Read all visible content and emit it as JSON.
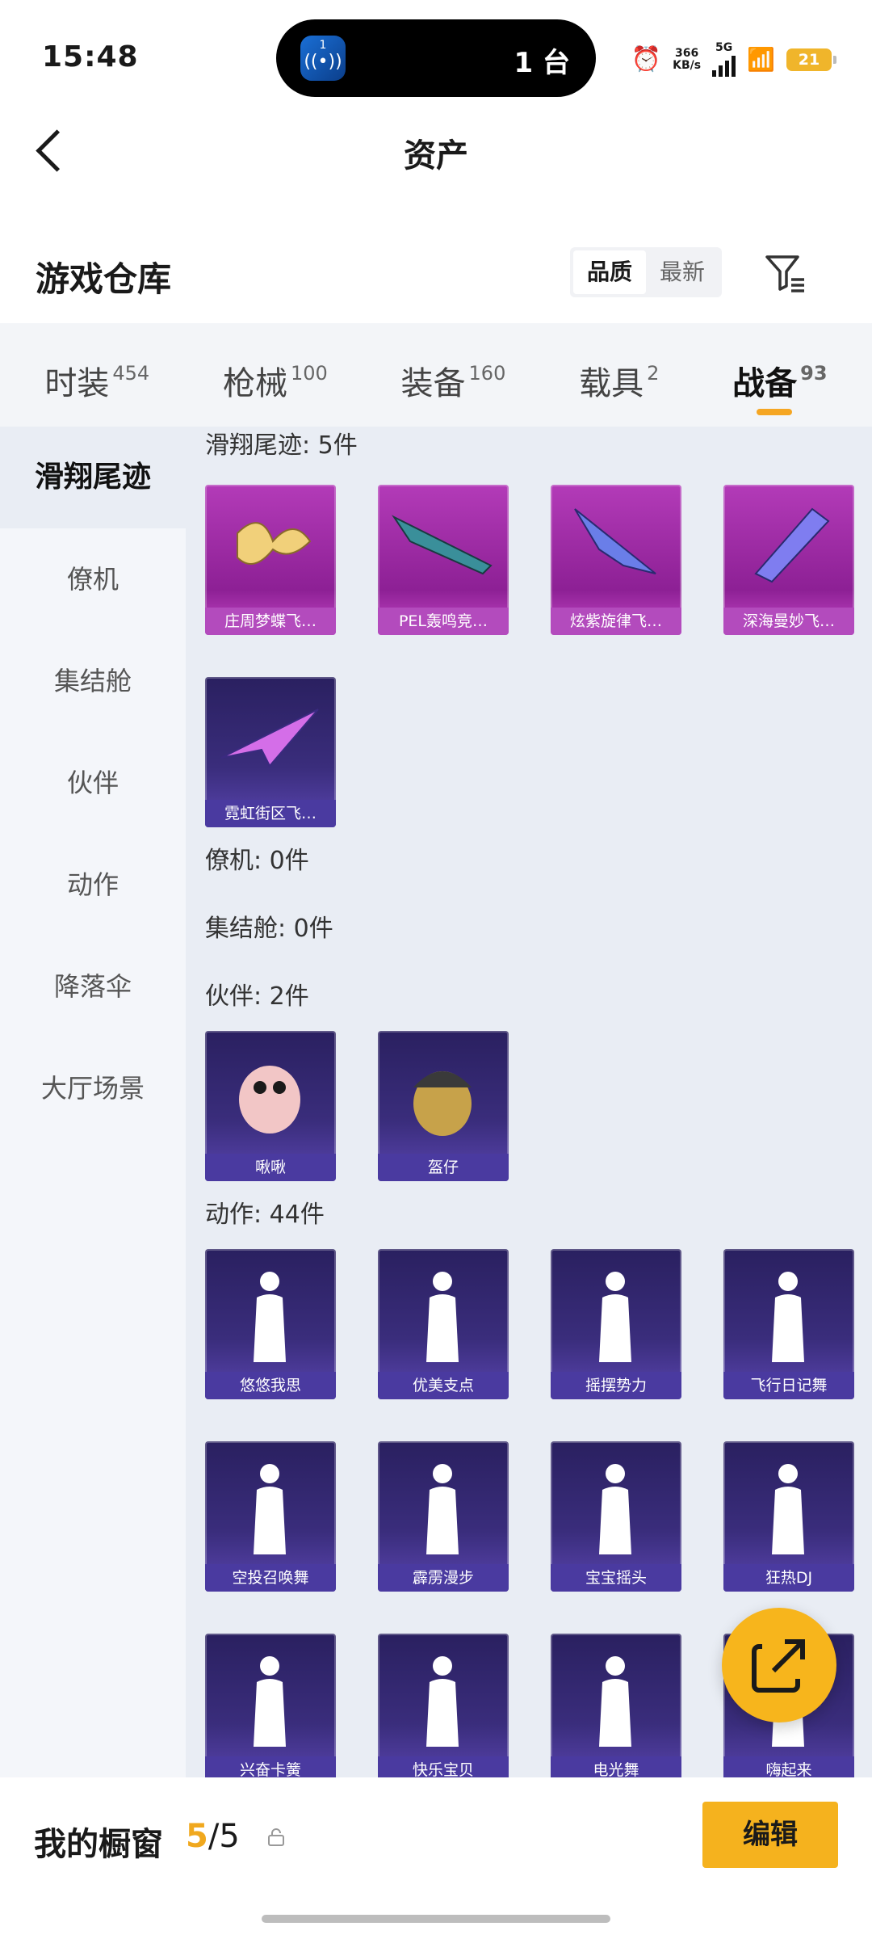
{
  "status": {
    "time": "15:48",
    "island_icon_num": "1",
    "island_text": "1 台",
    "net_speed_top": "366",
    "net_speed_unit": "KB/s",
    "network": "5G",
    "battery": "21"
  },
  "nav": {
    "title": "资产"
  },
  "header": {
    "title": "游戏仓库",
    "sort_quality": "品质",
    "sort_newest": "最新"
  },
  "tabs": [
    {
      "label": "时装",
      "count": "454"
    },
    {
      "label": "枪械",
      "count": "100"
    },
    {
      "label": "装备",
      "count": "160"
    },
    {
      "label": "载具",
      "count": "2"
    },
    {
      "label": "战备",
      "count": "93"
    }
  ],
  "sidebar": [
    "滑翔尾迹",
    "僚机",
    "集结舱",
    "伙伴",
    "动作",
    "降落伞",
    "大厅场景"
  ],
  "groups": {
    "glide": {
      "title": "滑翔尾迹: 5件",
      "items": [
        "庄周梦蝶飞…",
        "PEL轰鸣竞…",
        "炫紫旋律飞…",
        "深海曼妙飞…",
        "霓虹街区飞…"
      ]
    },
    "wingman": {
      "title": "僚机: 0件"
    },
    "pod": {
      "title": "集结舱: 0件"
    },
    "partner": {
      "title": "伙伴: 2件",
      "items": [
        "啾啾",
        "盔仔"
      ]
    },
    "emote": {
      "title": "动作: 44件",
      "items": [
        "悠悠我思",
        "优美支点",
        "摇摆势力",
        "飞行日记舞",
        "空投召唤舞",
        "霹雳漫步",
        "宝宝摇头",
        "狂热DJ",
        "兴奋卡簧",
        "快乐宝贝",
        "电光舞",
        "嗨起来"
      ]
    }
  },
  "bottom": {
    "label": "我的橱窗",
    "count_current": "5",
    "count_total": "/5",
    "edit": "编辑"
  },
  "colors": {
    "accent": "#f5b21e",
    "epic": "#b33bb8",
    "legendary": "#4a3aa0"
  },
  "icons": {
    "back": "chevron-left-icon",
    "filter": "filter-icon",
    "share": "share-external-icon",
    "lock": "lock-icon"
  }
}
